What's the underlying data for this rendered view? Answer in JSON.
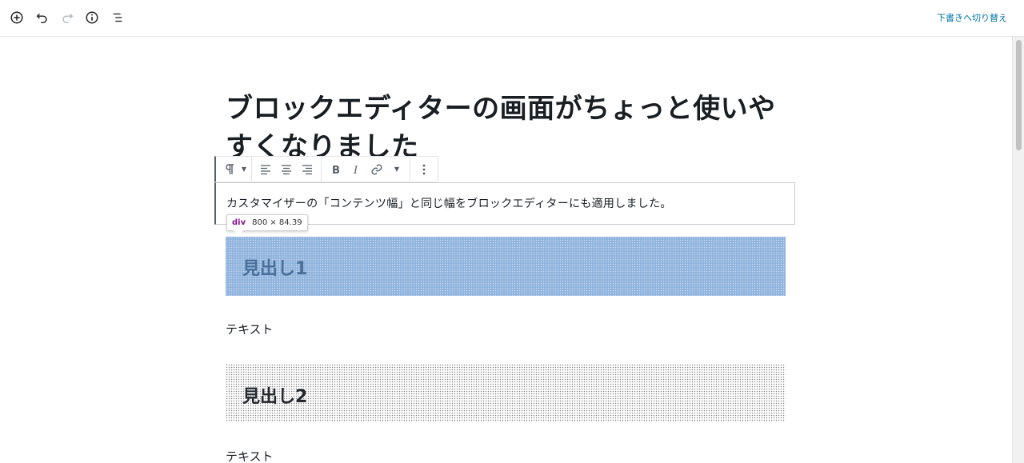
{
  "header": {
    "icons": [
      "add-block-icon",
      "undo-icon",
      "redo-icon",
      "info-icon",
      "outline-icon"
    ],
    "switch_to_draft": "下書きへ切り替え"
  },
  "post": {
    "title": "ブロックエディターの画面がちょっと使いやすくなりました"
  },
  "toolbar": {
    "icons": [
      "paragraph-icon",
      "align-left-icon",
      "align-center-icon",
      "align-right-icon",
      "bold-icon",
      "italic-icon",
      "link-icon",
      "more-options-icon"
    ]
  },
  "blocks": {
    "paragraph": "カスタマイザーの「コンテンツ幅」と同じ幅をブロックエディターにも適用しました。",
    "heading1": "見出し1",
    "text1": "テキスト",
    "heading2": "見出し2",
    "text2": "テキスト"
  },
  "inspector_tooltip": {
    "tag": "div",
    "dimensions": "800 × 84.39"
  },
  "colors": {
    "link": "#0073aa",
    "heading1_bg": "#8fb3dd",
    "heading1_text": "#4a6f99"
  }
}
